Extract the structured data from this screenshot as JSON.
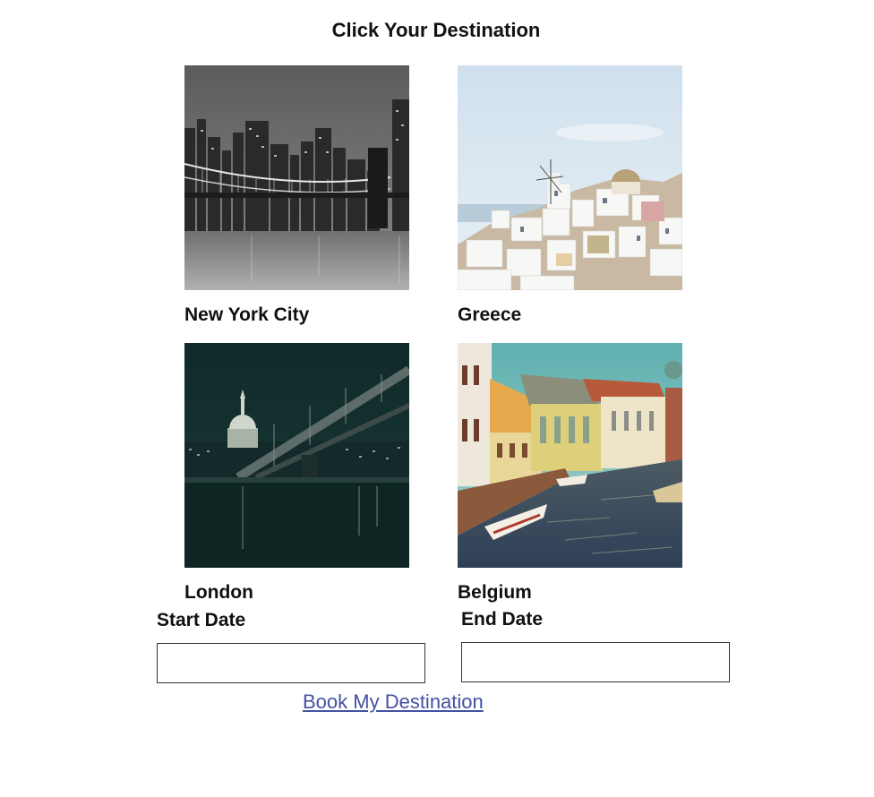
{
  "page": {
    "title": "Click Your Destination"
  },
  "destinations": [
    {
      "label": "New York City",
      "image": "new-york-city-bridge-photo"
    },
    {
      "label": "Greece",
      "image": "greece-santorini-photo"
    },
    {
      "label": "London",
      "image": "london-millennium-bridge-photo"
    },
    {
      "label": "Belgium",
      "image": "belgium-canal-photo"
    }
  ],
  "booking": {
    "start_label": "Start Date",
    "start_value": "",
    "end_label": "End Date",
    "end_value": "",
    "submit_label": "Book My Destination"
  },
  "colors": {
    "link": "#4451a3",
    "input_border": "#333333",
    "text": "#111111"
  }
}
